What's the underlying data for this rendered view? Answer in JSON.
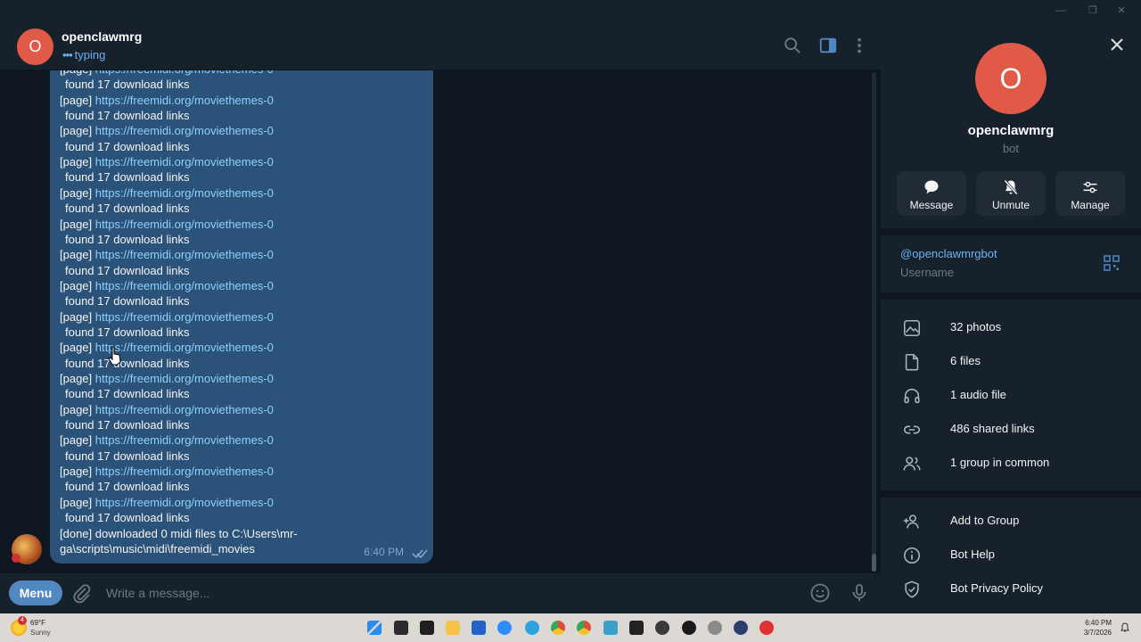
{
  "chat": {
    "name": "openclawmrg",
    "avatar_letter": "O",
    "status": "typing",
    "status_dots": "•••"
  },
  "message": {
    "lines": [
      {
        "prefix": "[page] ",
        "link": "https://freemidi.org/moviethemes-0"
      },
      {
        "text": "found 17 download links"
      },
      {
        "prefix": "[page] ",
        "link": "https://freemidi.org/moviethemes-0"
      },
      {
        "text": "found 17 download links"
      },
      {
        "prefix": "[page] ",
        "link": "https://freemidi.org/moviethemes-0"
      },
      {
        "text": "found 17 download links"
      },
      {
        "prefix": "[page] ",
        "link": "https://freemidi.org/moviethemes-0"
      },
      {
        "text": "found 17 download links"
      },
      {
        "prefix": "[page] ",
        "link": "https://freemidi.org/moviethemes-0"
      },
      {
        "text": "found 17 download links"
      },
      {
        "prefix": "[page] ",
        "link": "https://freemidi.org/moviethemes-0"
      },
      {
        "text": "found 17 download links"
      },
      {
        "prefix": "[page] ",
        "link": "https://freemidi.org/moviethemes-0"
      },
      {
        "text": "found 17 download links"
      },
      {
        "prefix": "[page] ",
        "link": "https://freemidi.org/moviethemes-0"
      },
      {
        "text": "found 17 download links"
      },
      {
        "prefix": "[page] ",
        "link": "https://freemidi.org/moviethemes-0"
      },
      {
        "text": "found 17 download links"
      },
      {
        "prefix": "[page] ",
        "link": "https://freemidi.org/moviethemes-0"
      },
      {
        "text": "found 17 download links"
      },
      {
        "prefix": "[page] ",
        "link": "https://freemidi.org/moviethemes-0"
      },
      {
        "text": "found 17 download links"
      },
      {
        "prefix": "[page] ",
        "link": "https://freemidi.org/moviethemes-0"
      },
      {
        "text": "found 17 download links"
      },
      {
        "prefix": "[page] ",
        "link": "https://freemidi.org/moviethemes-0"
      },
      {
        "text": "found 17 download links"
      },
      {
        "prefix": "[page] ",
        "link": "https://freemidi.org/moviethemes-0"
      },
      {
        "text": "found 17 download links"
      },
      {
        "prefix": "[page] ",
        "link": "https://freemidi.org/moviethemes-0"
      },
      {
        "text": "found 17 download links"
      },
      {
        "text": "[done] downloaded 0 midi files to C:\\Users\\mr-"
      },
      {
        "text": "ga\\scripts\\music\\midi\\freemidi_movies"
      }
    ],
    "time": "6:40 PM"
  },
  "composer": {
    "menu_label": "Menu",
    "placeholder": "Write a message..."
  },
  "profile": {
    "avatar_letter": "O",
    "name": "openclawmrg",
    "subtitle": "bot",
    "actions": [
      {
        "label": "Message",
        "icon": "message-icon"
      },
      {
        "label": "Unmute",
        "icon": "bell-off-icon"
      },
      {
        "label": "Manage",
        "icon": "sliders-icon"
      }
    ],
    "username": "@openclawmrgbot",
    "username_label": "Username",
    "media": [
      {
        "label": "32 photos",
        "icon": "photo-icon"
      },
      {
        "label": "6 files",
        "icon": "file-icon"
      },
      {
        "label": "1 audio file",
        "icon": "headphones-icon"
      },
      {
        "label": "486 shared links",
        "icon": "link-icon"
      },
      {
        "label": "1 group in common",
        "icon": "group-icon"
      }
    ],
    "bot_actions": [
      {
        "label": "Add to Group",
        "icon": "add-user-icon"
      },
      {
        "label": "Bot Help",
        "icon": "info-icon"
      },
      {
        "label": "Bot Privacy Policy",
        "icon": "shield-icon"
      }
    ]
  },
  "taskbar": {
    "weather_temp": "69°F",
    "weather_cond": "Sunny",
    "weather_badge": "4",
    "time": "6:40 PM",
    "date": "3/7/2026"
  },
  "colors": {
    "accent": "#5288c1",
    "bubble": "#2b5278",
    "link": "#8ed0ff",
    "avatar": "#e05a47"
  }
}
